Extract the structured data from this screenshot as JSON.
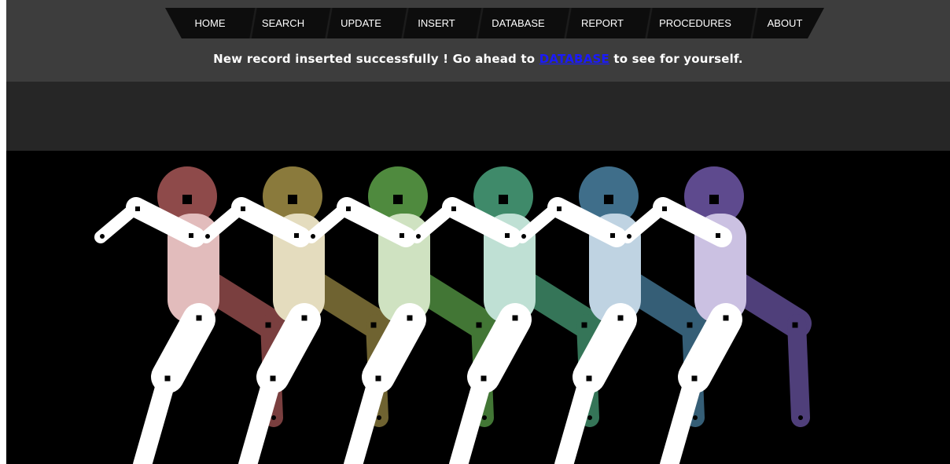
{
  "nav": {
    "items": [
      "HOME",
      "SEARCH",
      "UPDATE",
      "INSERT",
      "DATABASE",
      "REPORT",
      "PROCEDURES",
      "ABOUT"
    ]
  },
  "notice": {
    "before": "New record inserted successfully ! Go ahead to ",
    "link": "DATABASE",
    "after": " to see for yourself."
  },
  "hero": {
    "figures": [
      {
        "head": "#8e4a4a",
        "torso": "#e2bcbc",
        "legBack": "#7a3f3f"
      },
      {
        "head": "#8a7a3c",
        "torso": "#e4dcbe",
        "legBack": "#6f6331"
      },
      {
        "head": "#4f8a3e",
        "torso": "#cfe2c1",
        "legBack": "#427635"
      },
      {
        "head": "#3f8a6a",
        "torso": "#bfe0d4",
        "legBack": "#357558"
      },
      {
        "head": "#3f6e8a",
        "torso": "#bfd3e2",
        "legBack": "#355e76"
      },
      {
        "head": "#5e4a8e",
        "torso": "#cbc1e2",
        "legBack": "#4f3f7a"
      }
    ]
  },
  "colors": {
    "top_band": "#3d3d3d",
    "mid_band": "#262626",
    "navbar": "#0d0d0d",
    "link": "#1a1aff",
    "limb": "#ffffff"
  }
}
